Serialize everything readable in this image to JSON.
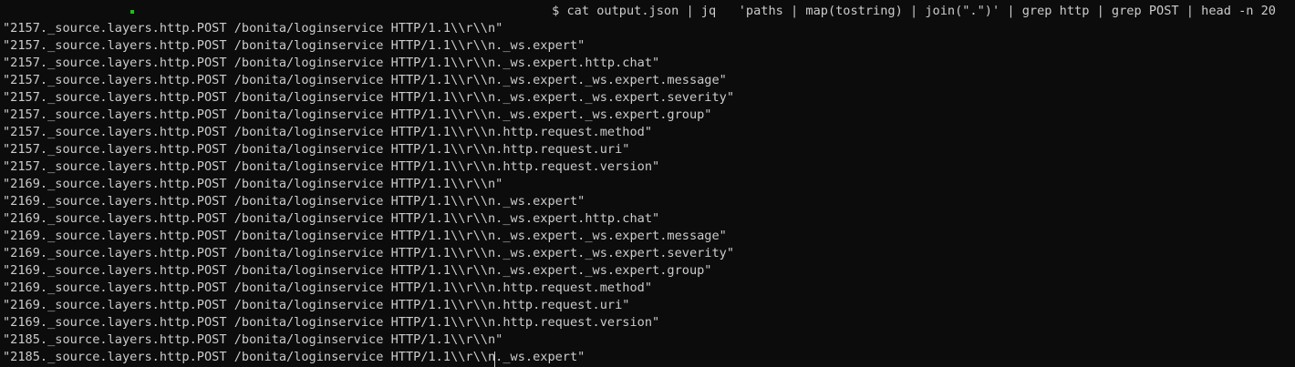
{
  "terminal": {
    "command": "$ cat output.json | jq   'paths | map(tostring) | join(\".\")' | grep http | grep POST | head -n 20",
    "lines": [
      "\"2157._source.layers.http.POST /bonita/loginservice HTTP/1.1\\\\r\\\\n\"",
      "\"2157._source.layers.http.POST /bonita/loginservice HTTP/1.1\\\\r\\\\n._ws.expert\"",
      "\"2157._source.layers.http.POST /bonita/loginservice HTTP/1.1\\\\r\\\\n._ws.expert.http.chat\"",
      "\"2157._source.layers.http.POST /bonita/loginservice HTTP/1.1\\\\r\\\\n._ws.expert._ws.expert.message\"",
      "\"2157._source.layers.http.POST /bonita/loginservice HTTP/1.1\\\\r\\\\n._ws.expert._ws.expert.severity\"",
      "\"2157._source.layers.http.POST /bonita/loginservice HTTP/1.1\\\\r\\\\n._ws.expert._ws.expert.group\"",
      "\"2157._source.layers.http.POST /bonita/loginservice HTTP/1.1\\\\r\\\\n.http.request.method\"",
      "\"2157._source.layers.http.POST /bonita/loginservice HTTP/1.1\\\\r\\\\n.http.request.uri\"",
      "\"2157._source.layers.http.POST /bonita/loginservice HTTP/1.1\\\\r\\\\n.http.request.version\"",
      "\"2169._source.layers.http.POST /bonita/loginservice HTTP/1.1\\\\r\\\\n\"",
      "\"2169._source.layers.http.POST /bonita/loginservice HTTP/1.1\\\\r\\\\n._ws.expert\"",
      "\"2169._source.layers.http.POST /bonita/loginservice HTTP/1.1\\\\r\\\\n._ws.expert.http.chat\"",
      "\"2169._source.layers.http.POST /bonita/loginservice HTTP/1.1\\\\r\\\\n._ws.expert._ws.expert.message\"",
      "\"2169._source.layers.http.POST /bonita/loginservice HTTP/1.1\\\\r\\\\n._ws.expert._ws.expert.severity\"",
      "\"2169._source.layers.http.POST /bonita/loginservice HTTP/1.1\\\\r\\\\n._ws.expert._ws.expert.group\"",
      "\"2169._source.layers.http.POST /bonita/loginservice HTTP/1.1\\\\r\\\\n.http.request.method\"",
      "\"2169._source.layers.http.POST /bonita/loginservice HTTP/1.1\\\\r\\\\n.http.request.uri\"",
      "\"2169._source.layers.http.POST /bonita/loginservice HTTP/1.1\\\\r\\\\n.http.request.version\"",
      "\"2185._source.layers.http.POST /bonita/loginservice HTTP/1.1\\\\r\\\\n\"",
      "\"2185._source.layers.http.POST /bonita/loginservice HTTP/1.1\\\\r\\\\n._ws.expert\""
    ],
    "colors": {
      "background": "#0c0c0c",
      "foreground": "#cccccc",
      "accent_green": "#16c60c"
    }
  }
}
